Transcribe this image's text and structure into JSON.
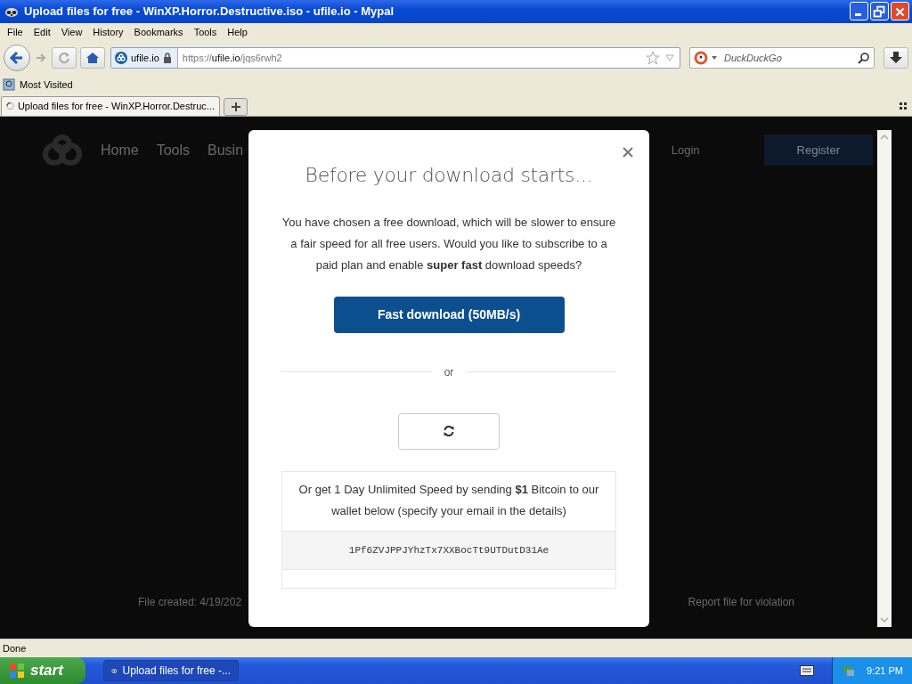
{
  "window": {
    "title": "Upload files for free - WinXP.Horror.Destructive.iso - ufile.io - Mypal"
  },
  "menu": [
    "File",
    "Edit",
    "View",
    "History",
    "Bookmarks",
    "Tools",
    "Help"
  ],
  "toolbar": {
    "site_label": "ufile.io",
    "url_prefix": "https://",
    "url_host": "ufile.io",
    "url_path": "/jqs6rwh2",
    "search": {
      "placeholder": "DuckDuckGo"
    }
  },
  "bookmarks": [
    "Most Visited"
  ],
  "tabs": [
    {
      "label": "Upload files for free - WinXP.Horror.Destruc...",
      "selected": true
    }
  ],
  "page": {
    "nav": [
      "Home",
      "Tools",
      "Busin"
    ],
    "login": "Login",
    "register": "Register",
    "file_created": "File created: 4/19/202",
    "report": "Report file for violation"
  },
  "modal": {
    "title": "Before your download starts...",
    "body": "You have chosen a free download, which will be slower to ensure a fair speed for all free users. Would you like to subscribe to a paid plan and enable **super fast** download speeds?",
    "fast_button": "Fast download (50MB/s)",
    "divider": "or",
    "bitcoin_text": "Or get 1 Day Unlimited Speed by sending **$1** Bitcoin to our wallet below (specify your email in the details)",
    "wallet": "1Pf6ZVJPPJYhzTx7XXBocTt9UTDutD31Ae"
  },
  "status_bar": "Done",
  "taskbar": {
    "start": "start",
    "tasks": [
      {
        "label": "Upload files for free -...",
        "selected": true
      }
    ],
    "clock": "9:21 PM"
  }
}
